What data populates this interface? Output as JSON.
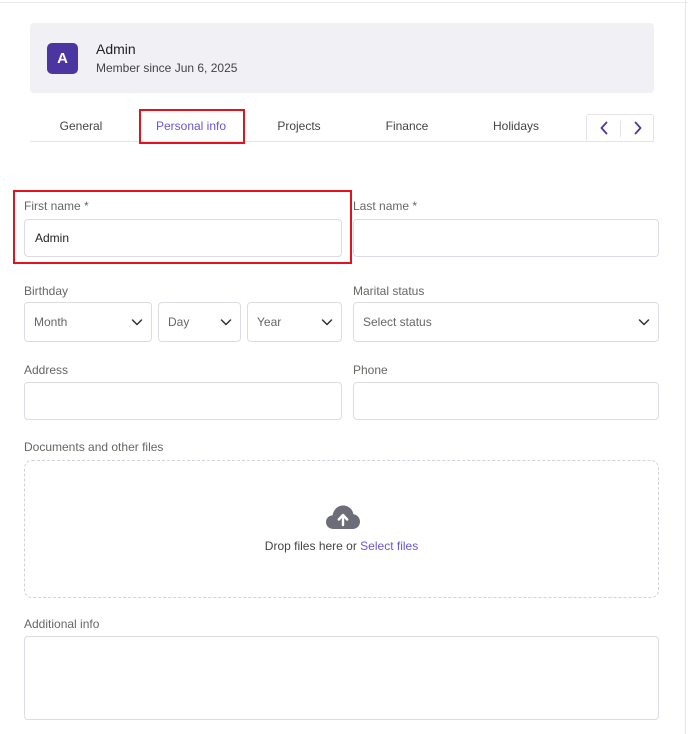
{
  "profile": {
    "avatar_letter": "A",
    "name": "Admin",
    "member_since": "Member since Jun 6, 2025",
    "avatar_color": "#4b35a0"
  },
  "tabs": [
    {
      "label": "General",
      "active": false
    },
    {
      "label": "Personal info",
      "active": true
    },
    {
      "label": "Projects",
      "active": false
    },
    {
      "label": "Finance",
      "active": false
    },
    {
      "label": "Holidays",
      "active": false
    }
  ],
  "tab_nav": {
    "prev_icon": "chevron-left-icon",
    "next_icon": "chevron-right-icon"
  },
  "form": {
    "first_name": {
      "label": "First name *",
      "value": "Admin"
    },
    "last_name": {
      "label": "Last name *",
      "value": ""
    },
    "birthday": {
      "label": "Birthday",
      "month": "Month",
      "day": "Day",
      "year": "Year"
    },
    "marital_status": {
      "label": "Marital status",
      "value": "Select status"
    },
    "address": {
      "label": "Address",
      "value": ""
    },
    "phone": {
      "label": "Phone",
      "value": ""
    },
    "documents": {
      "label": "Documents and other files",
      "drop_text": "Drop files here or ",
      "select_link": "Select files",
      "icon": "cloud-upload-icon"
    },
    "additional_info": {
      "label": "Additional info",
      "value": ""
    }
  },
  "colors": {
    "accent": "#6a55d6",
    "highlight": "#e2131f",
    "card_bg": "#f0f0f5"
  }
}
